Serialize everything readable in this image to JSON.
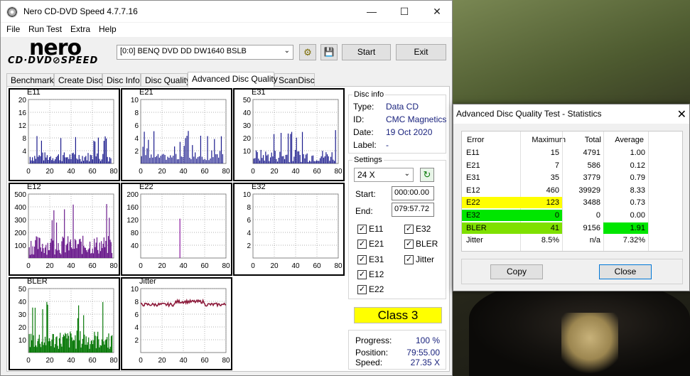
{
  "window": {
    "title": "Nero CD-DVD Speed 4.7.7.16",
    "minimize": "—",
    "maximize": "☐",
    "close": "✕"
  },
  "menu": [
    "File",
    "Run Test",
    "Extra",
    "Help"
  ],
  "logo": {
    "brand": "nero",
    "subtitle": "CD·DVD⊘SPEED"
  },
  "toolbar": {
    "drive": "[0:0]   BENQ DVD DD DW1640 BSLB",
    "start": "Start",
    "exit": "Exit"
  },
  "tabs": [
    "Benchmark",
    "Create Disc",
    "Disc Info",
    "Disc Quality",
    "Advanced Disc Quality",
    "ScanDisc"
  ],
  "active_tab": "Advanced Disc Quality",
  "disc_info": {
    "label": "Disc info",
    "rows": [
      {
        "key": "Type:",
        "value": "Data CD"
      },
      {
        "key": "ID:",
        "value": "CMC Magnetics"
      },
      {
        "key": "Date:",
        "value": "19 Oct 2020"
      },
      {
        "key": "Label:",
        "value": "-"
      }
    ]
  },
  "settings": {
    "label": "Settings",
    "speed": "24 X",
    "start_label": "Start:",
    "start_value": "000:00.00",
    "end_label": "End:",
    "end_value": "079:57.72",
    "checks_left": [
      "E11",
      "E21",
      "E31",
      "E12",
      "E22"
    ],
    "checks_right": [
      "E32",
      "BLER",
      "Jitter"
    ]
  },
  "class_label": "Class 3",
  "progress": {
    "rows": [
      {
        "key": "Progress:",
        "value": "100 %"
      },
      {
        "key": "Position:",
        "value": "79:55.00"
      },
      {
        "key": "Speed:",
        "value": "27.35 X"
      }
    ]
  },
  "colors": {
    "e11": "#1a1a8c",
    "e21": "#1a1a8c",
    "e31": "#1a1a8c",
    "e12": "#6a1a8c",
    "e22": "#8c1aa0",
    "bler": "#0a7a0a",
    "jitter": "#8c1a3a",
    "yellow": "#ffff00",
    "green": "#00e600"
  },
  "graphs": [
    {
      "name": "E11",
      "ticks": [
        "20",
        "16",
        "12",
        "8",
        "4"
      ],
      "x_ticks": [
        "0",
        "20",
        "40",
        "60",
        "80"
      ],
      "ymax": 20
    },
    {
      "name": "E21",
      "ticks": [
        "10",
        "8",
        "6",
        "4",
        "2"
      ],
      "x_ticks": [
        "0",
        "20",
        "40",
        "60",
        "80"
      ],
      "ymax": 10
    },
    {
      "name": "E31",
      "ticks": [
        "50",
        "40",
        "30",
        "20",
        "10"
      ],
      "x_ticks": [
        "0",
        "20",
        "40",
        "60",
        "80"
      ],
      "ymax": 50
    },
    {
      "name": "E12",
      "ticks": [
        "500",
        "400",
        "300",
        "200",
        "100"
      ],
      "x_ticks": [
        "0",
        "20",
        "40",
        "60",
        "80"
      ],
      "ymax": 500
    },
    {
      "name": "E22",
      "ticks": [
        "200",
        "160",
        "120",
        "80",
        "40"
      ],
      "x_ticks": [
        "0",
        "20",
        "40",
        "60",
        "80"
      ],
      "ymax": 200
    },
    {
      "name": "E32",
      "ticks": [
        "10",
        "8",
        "6",
        "4",
        "2"
      ],
      "x_ticks": [
        "0",
        "20",
        "40",
        "60",
        "80"
      ],
      "ymax": 10
    },
    {
      "name": "BLER",
      "ticks": [
        "50",
        "40",
        "30",
        "20",
        "10"
      ],
      "x_ticks": [
        "0",
        "20",
        "40",
        "60",
        "80"
      ],
      "ymax": 50
    },
    {
      "name": "Jitter",
      "ticks": [
        "10",
        "8",
        "6",
        "4",
        "2"
      ],
      "x_ticks": [
        "0",
        "20",
        "40",
        "60",
        "80"
      ],
      "ymax": 10
    }
  ],
  "stats": {
    "title": "Advanced Disc Quality Test - Statistics",
    "headers": [
      "Error",
      "Maximum",
      "Total",
      "Average"
    ],
    "rows": [
      {
        "error": "E11",
        "maximum": "15",
        "total": "4791",
        "average": "1.00",
        "err_hl": "",
        "max_hl": "",
        "avg_hl": ""
      },
      {
        "error": "E21",
        "maximum": "7",
        "total": "586",
        "average": "0.12",
        "err_hl": "",
        "max_hl": "",
        "avg_hl": ""
      },
      {
        "error": "E31",
        "maximum": "35",
        "total": "3779",
        "average": "0.79",
        "err_hl": "",
        "max_hl": "",
        "avg_hl": ""
      },
      {
        "error": "E12",
        "maximum": "460",
        "total": "39929",
        "average": "8.33",
        "err_hl": "",
        "max_hl": "",
        "avg_hl": ""
      },
      {
        "error": "E22",
        "maximum": "123",
        "total": "3488",
        "average": "0.73",
        "err_hl": "#ffff00",
        "max_hl": "#ffff00",
        "avg_hl": ""
      },
      {
        "error": "E32",
        "maximum": "0",
        "total": "0",
        "average": "0.00",
        "err_hl": "#00e600",
        "max_hl": "#00e600",
        "avg_hl": ""
      },
      {
        "error": "BLER",
        "maximum": "41",
        "total": "9156",
        "average": "1.91",
        "err_hl": "#7fe000",
        "max_hl": "#7fe000",
        "avg_hl": "#00e600"
      },
      {
        "error": "Jitter",
        "maximum": "8.5%",
        "total": "n/a",
        "average": "7.32%",
        "err_hl": "",
        "max_hl": "",
        "avg_hl": ""
      }
    ],
    "copy": "Copy",
    "close": "Close"
  }
}
